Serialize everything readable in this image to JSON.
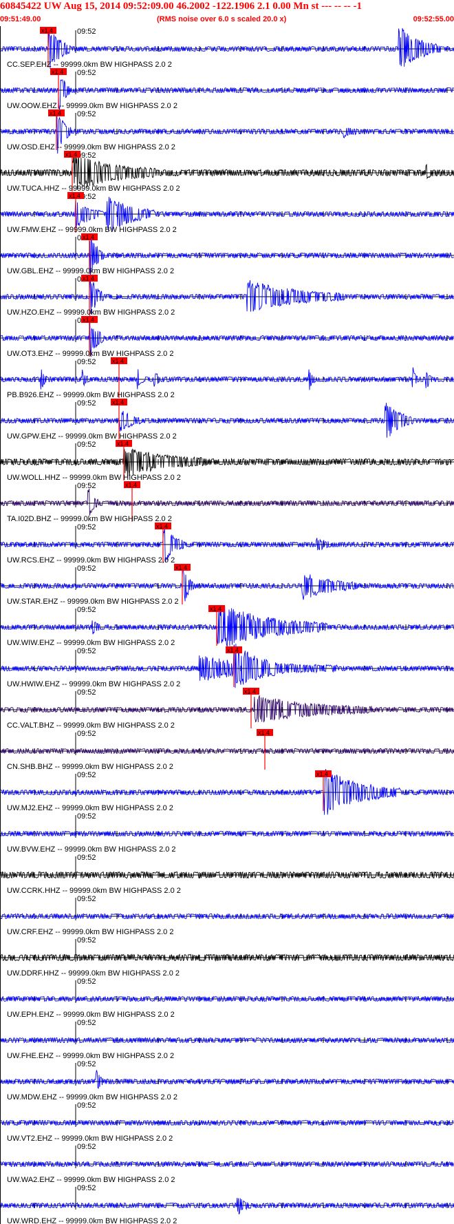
{
  "header": {
    "title": "60845422 UW Aug 15, 2014 09:52:09.00   46.2002 -122.1906  2.1 0.00 Mn st --- -- --   -1",
    "rms_note": "(RMS noise over 6.0 s scaled 20.0 x)",
    "time_start": "09:51:49.00",
    "time_end": "09:52:55.00"
  },
  "colors": {
    "title": "#ff0000",
    "trace_blue": "#0000ff",
    "trace_black": "#000000",
    "trace_purple": "#2a0066",
    "pick": "#ff0000",
    "axis": "#000000"
  },
  "chart_data": {
    "type": "line",
    "title": "60845422 UW Aug 15, 2014 09:52:09.00",
    "x_unit": "time",
    "xlim": [
      "09:51:49.00",
      "09:52:55.00"
    ],
    "minute_tick_label": "09:52",
    "pick_label": "x1.4",
    "filter": "99999.0km BW  HIGHPASS  2.0  2",
    "traces": [
      {
        "label": "CC.SEP.EHZ --",
        "color": "blue",
        "pick_s": 7.0,
        "bursts": [
          {
            "t": 7.2,
            "amp": 1.0,
            "dur": 3
          },
          {
            "t": 58.0,
            "amp": 1.0,
            "dur": 6
          }
        ]
      },
      {
        "label": "UW.OOW.EHZ --",
        "color": "blue",
        "pick_s": 8.5,
        "bursts": [
          {
            "t": 8.6,
            "amp": 1.0,
            "dur": 1.5
          }
        ]
      },
      {
        "label": "UW.OSD.EHZ --",
        "color": "blue",
        "pick_s": 8.2,
        "bursts": [
          {
            "t": 8.3,
            "amp": 1.0,
            "dur": 2
          },
          {
            "t": 50.0,
            "amp": 0.2,
            "dur": 2
          }
        ]
      },
      {
        "label": "UW.TUCA.HHZ --",
        "color": "black",
        "pick_s": 10.5,
        "bursts": [
          {
            "t": 10.6,
            "amp": 0.8,
            "dur": 12
          },
          {
            "t": 62.0,
            "amp": 0.3,
            "dur": 1
          }
        ]
      },
      {
        "label": "UW.FMW.EHZ --",
        "color": "blue",
        "pick_s": 11.0,
        "bursts": [
          {
            "t": 11.0,
            "amp": 0.6,
            "dur": 4
          },
          {
            "t": 15.5,
            "amp": 0.9,
            "dur": 7
          }
        ]
      },
      {
        "label": "UW.GBL.EHZ --",
        "color": "blue",
        "pick_s": 13.0,
        "bursts": [
          {
            "t": 13.1,
            "amp": 1.0,
            "dur": 2
          }
        ]
      },
      {
        "label": "UW.HZO.EHZ --",
        "color": "blue",
        "pick_s": 13.0,
        "bursts": [
          {
            "t": 13.1,
            "amp": 1.0,
            "dur": 2
          },
          {
            "t": 36.0,
            "amp": 0.7,
            "dur": 14
          }
        ]
      },
      {
        "label": "UW.OT3.EHZ --",
        "color": "blue",
        "pick_s": 13.0,
        "bursts": [
          {
            "t": 13.1,
            "amp": 0.9,
            "dur": 2
          }
        ]
      },
      {
        "label": "PB.B926.EHZ --",
        "color": "blue",
        "pick_s": 17.3,
        "bursts": [
          {
            "t": 6.0,
            "amp": 0.5,
            "dur": 0.8
          },
          {
            "t": 12.0,
            "amp": 0.4,
            "dur": 0.8
          },
          {
            "t": 20.0,
            "amp": 0.5,
            "dur": 0.8
          },
          {
            "t": 22.5,
            "amp": 0.4,
            "dur": 0.8
          },
          {
            "t": 45.0,
            "amp": 0.5,
            "dur": 0.8
          },
          {
            "t": 60.0,
            "amp": 0.5,
            "dur": 0.8
          },
          {
            "t": 62.0,
            "amp": 0.4,
            "dur": 0.8
          }
        ]
      },
      {
        "label": "UW.GPW.EHZ --",
        "color": "blue",
        "pick_s": 17.3,
        "bursts": [
          {
            "t": 17.5,
            "amp": 0.5,
            "dur": 3
          },
          {
            "t": 56.0,
            "amp": 0.9,
            "dur": 4
          }
        ]
      },
      {
        "label": "UW.WOLL.HHZ --",
        "color": "black",
        "pick_s": 18.0,
        "bursts": [
          {
            "t": 18.1,
            "amp": 0.6,
            "dur": 12
          }
        ]
      },
      {
        "label": "TA.I02D.BHZ --",
        "color": "purple",
        "pick_s": 19.2,
        "bursts": [
          {
            "t": 12.8,
            "amp": 0.7,
            "dur": 1.5
          }
        ]
      },
      {
        "label": "UW.RCS.EHZ --",
        "color": "blue",
        "pick_s": 23.7,
        "bursts": [
          {
            "t": 23.8,
            "amp": 0.9,
            "dur": 3
          },
          {
            "t": 46.0,
            "amp": 0.3,
            "dur": 2
          }
        ]
      },
      {
        "label": "UW.STAR.EHZ --",
        "color": "blue",
        "pick_s": 26.5,
        "bursts": [
          {
            "t": 26.6,
            "amp": 1.0,
            "dur": 1.5
          },
          {
            "t": 44.0,
            "amp": 0.6,
            "dur": 8
          }
        ]
      },
      {
        "label": "UW.WIW.EHZ --",
        "color": "blue",
        "pick_s": 31.5,
        "bursts": [
          {
            "t": 13.5,
            "amp": 0.4,
            "dur": 1
          },
          {
            "t": 31.6,
            "amp": 1.0,
            "dur": 16
          }
        ]
      },
      {
        "label": "UW.HWIW.EHZ --",
        "color": "blue",
        "pick_s": 34.0,
        "bursts": [
          {
            "t": 29.0,
            "amp": 0.5,
            "dur": 20
          },
          {
            "t": 34.1,
            "amp": 0.9,
            "dur": 6
          }
        ]
      },
      {
        "label": "CC.VALT.BHZ --",
        "color": "purple",
        "pick_s": 36.5,
        "bursts": [
          {
            "t": 37.0,
            "amp": 0.6,
            "dur": 17
          }
        ]
      },
      {
        "label": "CN.SHB.BHZ --",
        "color": "purple",
        "pick_s": 38.5,
        "bursts": []
      },
      {
        "label": "UW.MJ2.EHZ --",
        "color": "blue",
        "pick_s": 47.0,
        "bursts": [
          {
            "t": 47.2,
            "amp": 1.0,
            "dur": 11
          }
        ]
      },
      {
        "label": "UW.BVW.EHZ --",
        "color": "blue",
        "pick_s": null,
        "bursts": []
      },
      {
        "label": "UW.CCRK.HHZ --",
        "color": "black",
        "pick_s": null,
        "bursts": []
      },
      {
        "label": "UW.CRF.EHZ --",
        "color": "blue",
        "pick_s": null,
        "bursts": []
      },
      {
        "label": "UW.DDRF.HHZ --",
        "color": "black",
        "pick_s": null,
        "bursts": []
      },
      {
        "label": "UW.EPH.EHZ --",
        "color": "blue",
        "pick_s": null,
        "bursts": []
      },
      {
        "label": "UW.FHE.EHZ --",
        "color": "blue",
        "pick_s": null,
        "bursts": []
      },
      {
        "label": "UW.MDW.EHZ --",
        "color": "blue",
        "pick_s": null,
        "bursts": [
          {
            "t": 14.0,
            "amp": 0.5,
            "dur": 1
          }
        ]
      },
      {
        "label": "UW.VT2.EHZ --",
        "color": "blue",
        "pick_s": null,
        "bursts": []
      },
      {
        "label": "UW.WA2.EHZ --",
        "color": "blue",
        "pick_s": null,
        "bursts": []
      },
      {
        "label": "UW.WRD.EHZ --",
        "color": "blue",
        "pick_s": null,
        "bursts": [
          {
            "t": 34.5,
            "amp": 0.4,
            "dur": 2
          }
        ]
      }
    ]
  }
}
